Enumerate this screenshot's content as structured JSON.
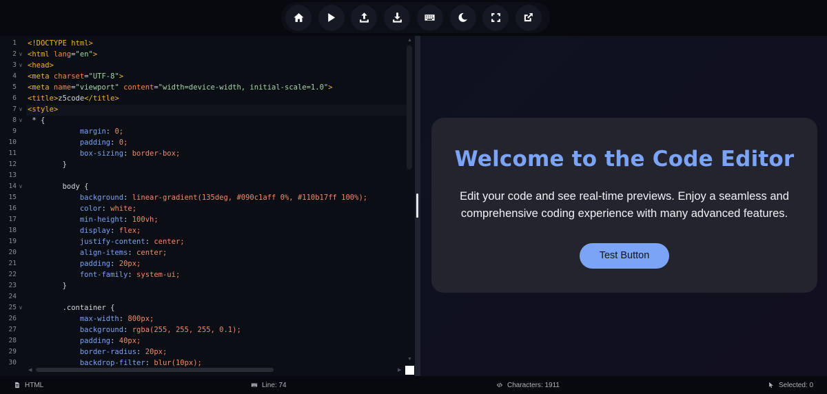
{
  "toolbar": {
    "buttons": [
      {
        "name": "home",
        "icon": "home-icon"
      },
      {
        "name": "run",
        "icon": "play-icon"
      },
      {
        "name": "upload",
        "icon": "upload-icon"
      },
      {
        "name": "download",
        "icon": "download-icon"
      },
      {
        "name": "keyboard",
        "icon": "keyboard-icon"
      },
      {
        "name": "theme",
        "icon": "moon-icon"
      },
      {
        "name": "fullscreen",
        "icon": "expand-icon"
      },
      {
        "name": "open-external",
        "icon": "external-link-icon"
      }
    ]
  },
  "editor": {
    "line_numbers": [
      "1",
      "2",
      "3",
      "4",
      "5",
      "6",
      "7",
      "8",
      "9",
      "10",
      "11",
      "12",
      "13",
      "14",
      "15",
      "16",
      "17",
      "18",
      "19",
      "20",
      "21",
      "22",
      "23",
      "24",
      "25",
      "26",
      "27",
      "28",
      "29",
      "30"
    ],
    "code_lines": [
      "<!DOCTYPE html>",
      "<html lang=\"en\">",
      "<head>",
      "<meta charset=\"UTF-8\">",
      "<meta name=\"viewport\" content=\"width=device-width, initial-scale=1.0\">",
      "<title>z5code</title>",
      "<style>",
      " * {",
      "            margin: 0;",
      "            padding: 0;",
      "            box-sizing: border-box;",
      "        }",
      "",
      "        body {",
      "            background: linear-gradient(135deg, #090c1aff 0%, #110b17ff 100%);",
      "            color: white;",
      "            min-height: 100vh;",
      "            display: flex;",
      "            justify-content: center;",
      "            align-items: center;",
      "            padding: 20px;",
      "            font-family: system-ui;",
      "        }",
      "",
      "        .container {",
      "            max-width: 800px;",
      "            background: rgba(255, 255, 255, 0.1);",
      "            padding: 40px;",
      "            border-radius: 20px;",
      "            backdrop-filter: blur(10px);"
    ],
    "fold_lines": [
      2,
      3,
      7,
      8,
      14,
      25
    ]
  },
  "preview": {
    "title": "Welcome to the Code Editor",
    "description": "Edit your code and see real-time previews. Enjoy a seamless and comprehensive coding experience with many advanced features.",
    "button_label": "Test Button"
  },
  "statusbar": {
    "language": "HTML",
    "line": "Line: 74",
    "characters": "Characters: 1911",
    "selected": "Selected: 0"
  },
  "colors": {
    "accent": "#7ba4f7",
    "tag": "#f0b429",
    "attr": "#f08a4b",
    "string": "#a5d6a7",
    "property": "#7ba4f0",
    "value": "#f28b6b"
  }
}
